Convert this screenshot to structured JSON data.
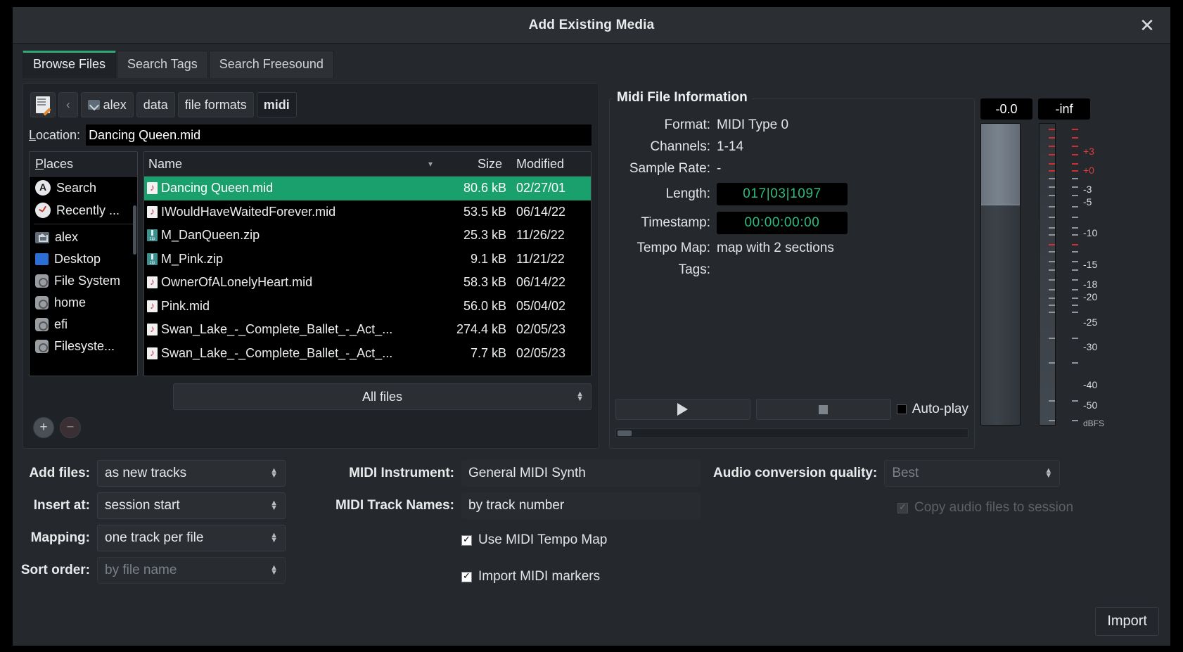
{
  "window": {
    "title": "Add Existing Media",
    "close_icon": "close-icon"
  },
  "tabs": [
    {
      "label": "Browse Files",
      "active": true
    },
    {
      "label": "Search Tags",
      "active": false
    },
    {
      "label": "Search Freesound",
      "active": false
    }
  ],
  "pathbar": {
    "edit_icon": "document-edit-icon",
    "back_icon": "chevron-left-icon",
    "crumbs": [
      "alex",
      "data",
      "file formats",
      "midi"
    ],
    "current": "midi"
  },
  "location": {
    "label": "Location:",
    "value": "Dancing Queen.mid"
  },
  "places": {
    "header": "Places",
    "items": [
      {
        "label": "Search",
        "icon": "search-circle-icon"
      },
      {
        "label": "Recently ...",
        "icon": "clock-icon"
      },
      {
        "label": "alex",
        "icon": "home-folder-icon"
      },
      {
        "label": "Desktop",
        "icon": "desktop-folder-icon"
      },
      {
        "label": "File System",
        "icon": "drive-icon"
      },
      {
        "label": "home",
        "icon": "drive-icon"
      },
      {
        "label": "efi",
        "icon": "drive-icon"
      },
      {
        "label": "Filesyste...",
        "icon": "drive-icon"
      }
    ],
    "add_label": "+",
    "remove_label": "−"
  },
  "filelist": {
    "columns": [
      "Name",
      "Size",
      "Modified"
    ],
    "rows": [
      {
        "name": "Dancing Queen.mid",
        "size": "80.6 kB",
        "modified": "02/27/01",
        "icon": "midi-file-icon",
        "selected": true
      },
      {
        "name": "IWouldHaveWaitedForever.mid",
        "size": "53.5 kB",
        "modified": "06/14/22",
        "icon": "midi-file-icon",
        "selected": false
      },
      {
        "name": "M_DanQueen.zip",
        "size": "25.3 kB",
        "modified": "11/26/22",
        "icon": "zip-file-icon",
        "selected": false
      },
      {
        "name": "M_Pink.zip",
        "size": "9.1 kB",
        "modified": "11/21/22",
        "icon": "zip-file-icon",
        "selected": false
      },
      {
        "name": "OwnerOfALonelyHeart.mid",
        "size": "58.3 kB",
        "modified": "06/14/22",
        "icon": "midi-file-icon",
        "selected": false
      },
      {
        "name": "Pink.mid",
        "size": "56.0 kB",
        "modified": "05/04/02",
        "icon": "midi-file-icon",
        "selected": false
      },
      {
        "name": "Swan_Lake_-_Complete_Ballet_-_Act_...",
        "size": "274.4 kB",
        "modified": "02/05/23",
        "icon": "midi-file-icon",
        "selected": false
      },
      {
        "name": "Swan_Lake_-_Complete_Ballet_-_Act_...",
        "size": "7.7 kB",
        "modified": "02/05/23",
        "icon": "midi-file-icon",
        "selected": false
      }
    ],
    "filter": "All files"
  },
  "midi_info": {
    "title": "Midi File Information",
    "format_label": "Format:",
    "format_value": "MIDI Type 0",
    "channels_label": "Channels:",
    "channels_value": "1-14",
    "sample_rate_label": "Sample Rate:",
    "sample_rate_value": "-",
    "length_label": "Length:",
    "length_value": "017|03|1097",
    "timestamp_label": "Timestamp:",
    "timestamp_value": "00:00:00:00",
    "tempo_map_label": "Tempo Map:",
    "tempo_map_value": "map with 2 sections",
    "tags_label": "Tags:",
    "tags_value": "",
    "play_icon": "play-icon",
    "stop_icon": "stop-icon",
    "autoplay_label": "Auto-play",
    "autoplay_checked": false
  },
  "meters": {
    "gain_readout": "-0.0",
    "peak_readout": "-inf",
    "unit_label": "dBFS",
    "scale": [
      "+3",
      "+0",
      "-3",
      "-5",
      "-10",
      "-15",
      "-18",
      "-20",
      "-25",
      "-30",
      "-40",
      "-50"
    ],
    "red_labels": [
      "+3",
      "+0"
    ],
    "accent_red": "#e03a3a"
  },
  "options": {
    "add_files": {
      "label": "Add files:",
      "value": "as new tracks"
    },
    "insert_at": {
      "label": "Insert at:",
      "value": "session start"
    },
    "mapping": {
      "label": "Mapping:",
      "value": "one track per file"
    },
    "sort_order": {
      "label": "Sort order:",
      "value": "by file name",
      "disabled": true
    },
    "midi_instrument": {
      "label": "MIDI Instrument:",
      "value": "General MIDI Synth"
    },
    "midi_track_names": {
      "label": "MIDI Track Names:",
      "value": "by track number"
    },
    "use_tempo_map": {
      "label": "Use MIDI Tempo Map",
      "checked": true
    },
    "import_markers": {
      "label": "Import MIDI markers",
      "checked": true
    },
    "audio_quality": {
      "label": "Audio conversion quality:",
      "value": "Best",
      "disabled": true
    },
    "copy_audio": {
      "label": "Copy audio files to session",
      "checked": true,
      "disabled": true
    }
  },
  "footer": {
    "import_label": "Import"
  },
  "colors": {
    "selection_green": "#1aa06d",
    "clock_green": "#2fbb7e",
    "tab_accent": "#2faa74",
    "window_bg": "#25282c"
  }
}
